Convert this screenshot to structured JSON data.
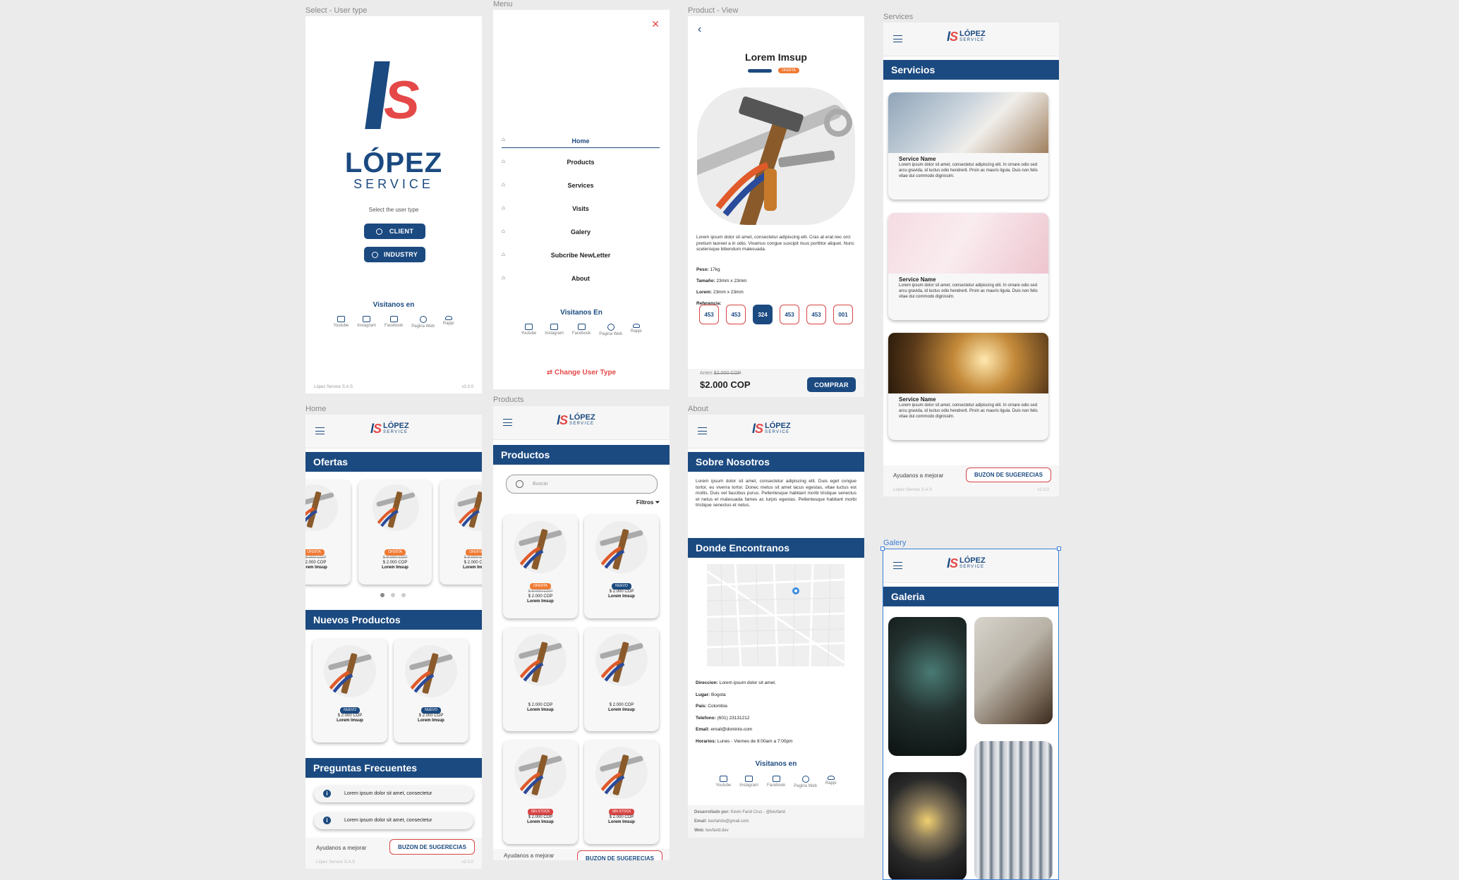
{
  "labels": {
    "select": "Select - User type",
    "menu": "Menu",
    "product": "Product - View",
    "services": "Services",
    "home": "Home",
    "products": "Products",
    "about": "About",
    "galery": "Galery"
  },
  "brand": {
    "ls_l": "l",
    "ls_s": "S",
    "name": "LÓPEZ",
    "service": "SERVICE",
    "mini_name": "LÓPEZ",
    "mini_service": "SERVICE"
  },
  "select": {
    "prompt": "Select the user type",
    "client": "CLIENT",
    "industry": "INDUSTRY",
    "visit": "Visitanos en",
    "footer_left": "López Service S.A.S",
    "footer_right": "v2.0.0"
  },
  "social": [
    {
      "label": "Youtube",
      "icon": "youtube-icon"
    },
    {
      "label": "Instagram",
      "icon": "instagram-icon"
    },
    {
      "label": "Facebook",
      "icon": "facebook-icon"
    },
    {
      "label": "Pagina Web",
      "icon": "web-icon"
    },
    {
      "label": "Rappi",
      "icon": "rappi-icon"
    }
  ],
  "menu": {
    "items": [
      "Home",
      "Products",
      "Services",
      "Visits",
      "Galery",
      "Subcribe NewLetter",
      "About"
    ],
    "visit": "Visitanos En",
    "change": "Change User Type"
  },
  "product": {
    "title": "Lorem Imsup",
    "badge": "OFERTA",
    "desc": "Lorem ipsum dolor sit amet, consectetur adipiscing elit. Cras at erat nec orci pretium laoreet a in odio. Vivamus congue suscipit risus porttitor aliquet. Nunc scelerisque bibendum malesuada.",
    "specs": [
      {
        "k": "Peso:",
        "v": "17kg"
      },
      {
        "k": "Tamaño:",
        "v": "23mm x 23mm"
      },
      {
        "k": "Lorem:",
        "v": "23mm x 23mm"
      },
      {
        "k": "Referencia:",
        "v": ""
      }
    ],
    "refs": [
      "453",
      "453",
      "324",
      "453",
      "453",
      "001"
    ],
    "before_label": "Antes",
    "before": "$2.000 COP",
    "price": "$2.000 COP",
    "buy": "COMPRAR"
  },
  "services": {
    "title": "Servicios",
    "name": "Service Name",
    "text": "Lorem ipsum dolor sit amet, consectetur adipiscing elit. In ornare odio sed arcu gravida, id luctus odio hendrerit. Proin ac mauris ligula. Duis non felis vitae dui commodo dignissim.",
    "help": "Ayudanos a mejorar",
    "buzon": "BUZON DE SUGERECIAS",
    "footer_left": "López Service S.A.S",
    "footer_right": "v2.0.0"
  },
  "home": {
    "ofertas": "Ofertas",
    "nuevos": "Nuevos Productos",
    "faq": "Preguntas Frecuentes",
    "faq_item": "Lorem ipsum dolor sit amet, consectetur",
    "badge_o": "OFERTA",
    "badge_n": "NUEVO",
    "old": "$ 8.000 COP",
    "price": "$ 2.000 COP",
    "name": "Lorem Imsup",
    "help": "Ayudanos a mejorar",
    "buzon": "BUZON DE SUGERECIAS",
    "footer_left": "López Service S.A.S",
    "footer_right": "v2.0.0"
  },
  "products": {
    "title": "Productos",
    "search": "Buscar",
    "filters": "Filtros",
    "badge_o": "OFERTA",
    "badge_n": "NUEVO",
    "badge_s": "SIN STOCK",
    "old": "$ 8.000 COP",
    "price": "$ 2.000 COP",
    "name": "Lorem Imsup",
    "help": "Ayudanos a mejorar",
    "buzon": "BUZON DE SUGERECIAS"
  },
  "about": {
    "title": "Sobre Nosotros",
    "text": "Lorem ipsum dolor sit amet, consectetur adipiscing elit. Duis eget congue tortor, eu viverra tortor. Donec metus sit amet lacus egestas, vitae luctus est mollis. Duis vel faucibus purus. Pellentesque habitant morbi tristique senectus et netus et malesuada fames ac turpis egestas. Pellentesque habitant morbi tristique senectus et netus.",
    "where": "Donde Encontranos",
    "info": [
      {
        "k": "Direccion:",
        "v": "Lorem ipsum dolor sit amet."
      },
      {
        "k": "Lugar:",
        "v": "Bogota"
      },
      {
        "k": "Pais:",
        "v": "Colombia"
      },
      {
        "k": "Telefono:",
        "v": "(601) 23131212"
      },
      {
        "k": "Email:",
        "v": "email@dominio.com"
      },
      {
        "k": "Horarios:",
        "v": "Lunes - Viernes de 8:00am a 7:00pm"
      }
    ],
    "visit": "Visitanos en",
    "dev": [
      {
        "k": "Desarrollado por:",
        "v": "Kevin Farid Cruz - @kevfarid"
      },
      {
        "k": "Email:",
        "v": "kevfarido@gmail.com"
      },
      {
        "k": "Web:",
        "v": "kevfarid.dev"
      }
    ]
  },
  "gallery": {
    "title": "Galeria"
  },
  "colors": {
    "navy": "#1b4a80",
    "red": "#e54848",
    "orange": "#f07a33"
  }
}
